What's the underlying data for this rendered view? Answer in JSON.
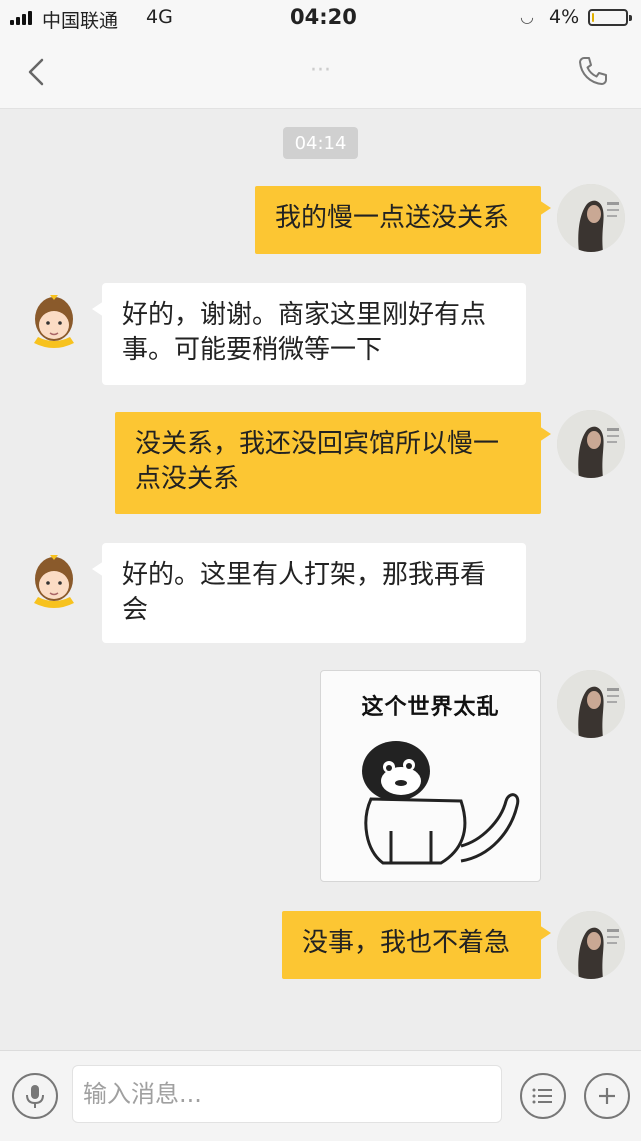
{
  "status_bar": {
    "carrier": "中国联通",
    "network": "4G",
    "time": "04:20",
    "battery_percent_label": "4%",
    "battery_level": 0.04
  },
  "nav": {
    "title": "···",
    "back_icon": "chevron-left-icon",
    "call_icon": "phone-icon"
  },
  "chat": {
    "timestamp": "04:14",
    "messages": [
      {
        "side": "out",
        "text": "我的慢一点送没关系"
      },
      {
        "side": "in",
        "text": "好的，谢谢。商家这里刚好有点事。可能要稍微等一下"
      },
      {
        "side": "out",
        "text": "没关系，我还没回宾馆所以慢一点没关系"
      },
      {
        "side": "in",
        "text": "好的。这里有人打架，那我再看会"
      },
      {
        "side": "out",
        "type": "sticker",
        "caption": "这个世界太乱"
      },
      {
        "side": "out",
        "text": "没事，我也不着急"
      }
    ]
  },
  "input_bar": {
    "placeholder": "输入消息...",
    "voice_icon": "microphone-icon",
    "menu_icon": "list-icon",
    "add_icon": "plus-icon"
  },
  "colors": {
    "outgoing_bubble": "#fcc633",
    "incoming_bubble": "#ffffff",
    "background": "#ededed"
  }
}
